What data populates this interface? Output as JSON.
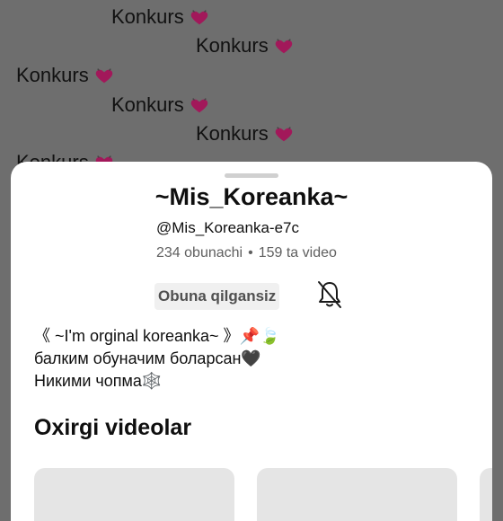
{
  "background_comments": [
    "Konkurs",
    "Konkurs",
    "Konkurs",
    "Konkurs",
    "Konkurs",
    "Konkurs"
  ],
  "channel": {
    "name": "~Mis_Koreanka~",
    "handle": "@Mis_Koreanka-e7c",
    "subscribers": "234 obunachi",
    "separator": "•",
    "videos": "159 ta video"
  },
  "subscribe_button": {
    "label": "Obuna qilgansiz"
  },
  "notification_icon": "bell-off-icon",
  "description": {
    "line1": "《 ~I'm orginal koreanka~ 》📌🍃",
    "line2": "балким обуначим боларсан🖤",
    "line3": "Никими чопма🕸️"
  },
  "section": {
    "title": "Oxirgi videolar"
  },
  "colors": {
    "overlay": "#6e6e6e",
    "sheet": "#ffffff",
    "heart": "#c2185b",
    "text_primary": "#0f0f0f",
    "text_secondary": "#606060"
  }
}
